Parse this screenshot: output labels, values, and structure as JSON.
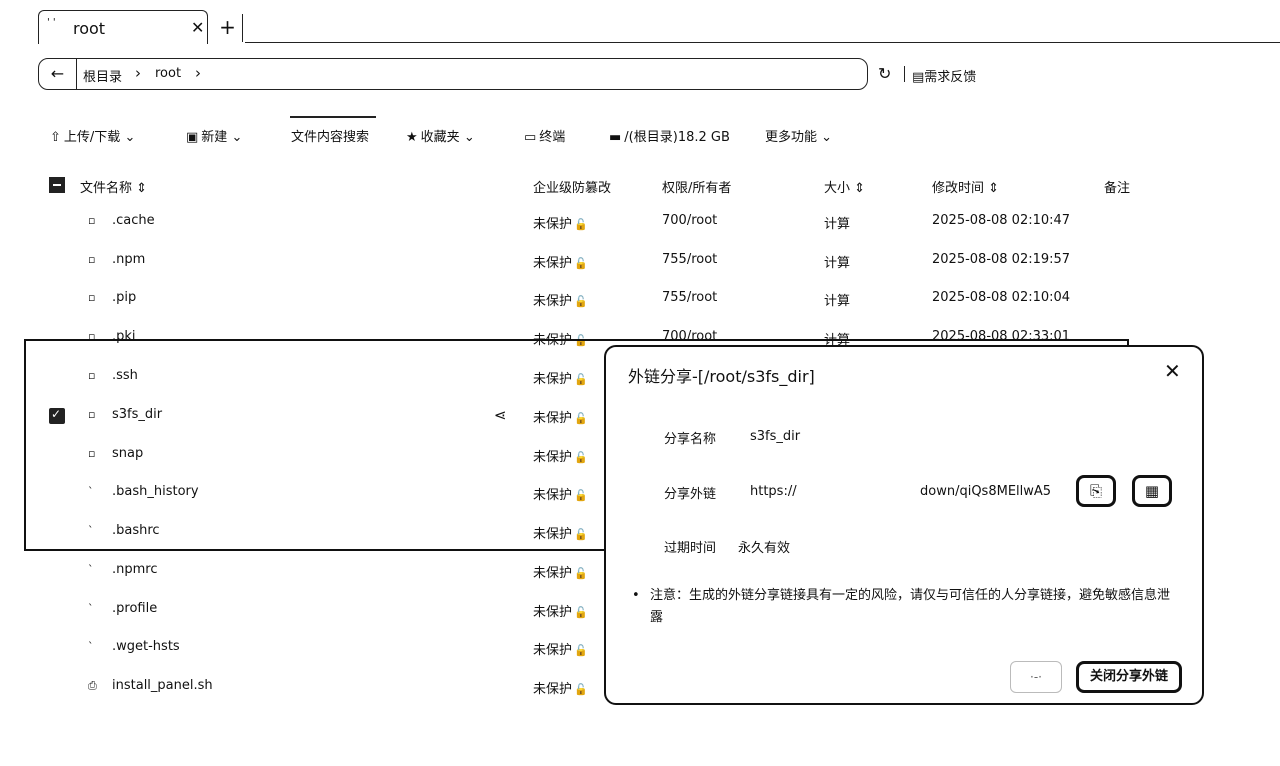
{
  "tabbar": {
    "tab_title": "root",
    "close_glyph": "✕",
    "new_tab_glyph": "+"
  },
  "address": {
    "back_glyph": "←",
    "crumbs": [
      "根目录",
      "root"
    ],
    "sep_glyph": "›",
    "refresh_glyph": "↻",
    "feedback_label": "需求反馈"
  },
  "toolbar": {
    "upload": "上传/下载",
    "new": "新建",
    "content_search": "文件内容搜索",
    "favorites": "收藏夹",
    "terminal": "终端",
    "disk": "/(根目录)18.2 GB",
    "more": "更多功能",
    "chevron": "⌄"
  },
  "table": {
    "headers": {
      "name": "文件名称",
      "protect": "企业级防篡改",
      "perm": "权限/所有者",
      "size": "大小",
      "mtime": "修改时间",
      "remark": "备注",
      "sort_glyph": "⇕"
    },
    "lock_glyph": "🔓",
    "rows": [
      {
        "name": ".cache",
        "protect": "未保护",
        "perm": "700/root",
        "size": "计算",
        "mtime": "2025-08-08 02:10:47"
      },
      {
        "name": ".npm",
        "protect": "未保护",
        "perm": "755/root",
        "size": "计算",
        "mtime": "2025-08-08 02:19:57"
      },
      {
        "name": ".pip",
        "protect": "未保护",
        "perm": "755/root",
        "size": "计算",
        "mtime": "2025-08-08 02:10:04"
      },
      {
        "name": ".pki",
        "protect": "未保护",
        "perm": "700/root",
        "size": "计算",
        "mtime": "2025-08-08 02:33:01"
      },
      {
        "name": ".ssh",
        "protect": "未保护",
        "perm": "",
        "size": "",
        "mtime": ""
      },
      {
        "name": "s3fs_dir",
        "protect": "未保护",
        "perm": "",
        "size": "",
        "mtime": ""
      },
      {
        "name": "snap",
        "protect": "未保护",
        "perm": "",
        "size": "",
        "mtime": ""
      },
      {
        "name": ".bash_history",
        "protect": "未保护",
        "perm": "",
        "size": "",
        "mtime": ""
      },
      {
        "name": ".bashrc",
        "protect": "未保护",
        "perm": "",
        "size": "",
        "mtime": ""
      },
      {
        "name": ".npmrc",
        "protect": "未保护",
        "perm": "",
        "size": "",
        "mtime": ""
      },
      {
        "name": ".profile",
        "protect": "未保护",
        "perm": "",
        "size": "",
        "mtime": ""
      },
      {
        "name": ".wget-hsts",
        "protect": "未保护",
        "perm": "",
        "size": "",
        "mtime": ""
      },
      {
        "name": "install_panel.sh",
        "protect": "未保护",
        "perm": "",
        "size": "",
        "mtime": ""
      }
    ]
  },
  "modal": {
    "title": "外链分享-[/root/s3fs_dir]",
    "close_glyph": "✕",
    "share_name_label": "分享名称",
    "share_name_value": "s3fs_dir",
    "share_link_label": "分享外链",
    "share_link_prefix": "https://",
    "share_link_suffix": "down/qiQs8MEllwA5",
    "expire_label": "过期时间",
    "expire_value": "永久有效",
    "note": "注意：生成的外链分享链接具有一定的风险，请仅与可信任的人分享链接，避免敏感信息泄露",
    "close_share_button": "关闭分享外链"
  }
}
